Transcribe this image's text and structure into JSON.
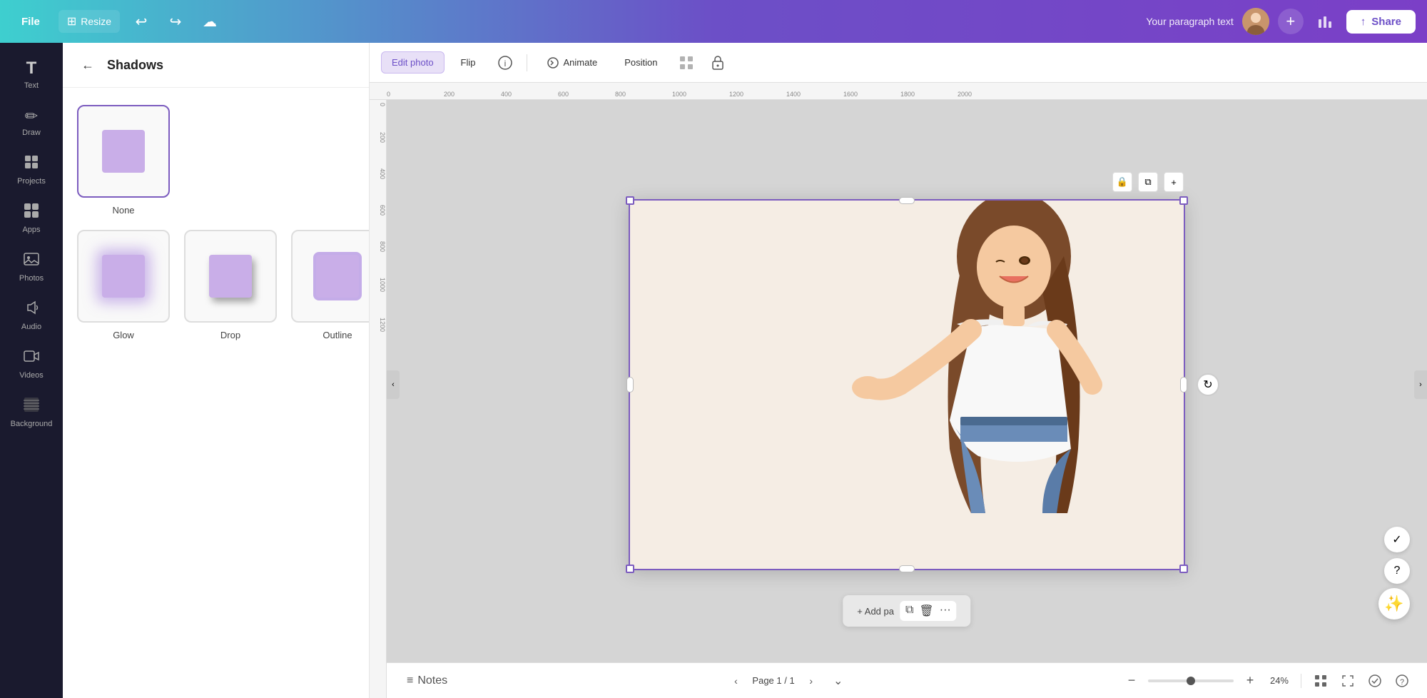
{
  "topbar": {
    "file_label": "File",
    "resize_label": "Resize",
    "undo_icon": "↩",
    "redo_icon": "↪",
    "cloud_icon": "☁",
    "paragraph_text": "Your paragraph text",
    "plus_icon": "+",
    "share_icon": "↑",
    "share_label": "Share"
  },
  "sidebar": {
    "items": [
      {
        "id": "text",
        "label": "Text",
        "icon": "T"
      },
      {
        "id": "draw",
        "label": "Draw",
        "icon": "✏"
      },
      {
        "id": "projects",
        "label": "Projects",
        "icon": "□"
      },
      {
        "id": "apps",
        "label": "Apps",
        "icon": "⊞"
      },
      {
        "id": "photos",
        "label": "Photos",
        "icon": "🖼"
      },
      {
        "id": "audio",
        "label": "Audio",
        "icon": "♪"
      },
      {
        "id": "videos",
        "label": "Videos",
        "icon": "▶"
      },
      {
        "id": "background",
        "label": "Background",
        "icon": "▨"
      }
    ]
  },
  "panel": {
    "back_icon": "←",
    "title": "Shadows",
    "shadows": [
      {
        "id": "none",
        "label": "None",
        "selected": true
      },
      {
        "id": "glow",
        "label": "Glow",
        "selected": false
      },
      {
        "id": "drop",
        "label": "Drop",
        "selected": false
      },
      {
        "id": "outline",
        "label": "Outline",
        "selected": false
      }
    ]
  },
  "toolbar": {
    "edit_photo_label": "Edit photo",
    "flip_label": "Flip",
    "info_icon": "ⓘ",
    "animate_label": "Animate",
    "position_label": "Position",
    "grid_icon": "⊞",
    "lock_icon": "🔒"
  },
  "ruler": {
    "marks": [
      "0",
      "200",
      "400",
      "600",
      "800",
      "1000",
      "1200",
      "1400",
      "1600",
      "1800",
      "2000"
    ],
    "v_marks": [
      "0",
      "200",
      "400",
      "600",
      "800",
      "1000",
      "1200"
    ]
  },
  "bottom_bar": {
    "notes_icon": "≡",
    "notes_label": "Notes",
    "page_info": "Page 1 / 1",
    "zoom_level": "24%",
    "grid_icon": "⊞",
    "expand_icon": "⤡",
    "check_icon": "✓",
    "help_icon": "?"
  },
  "canvas": {
    "add_page_text": "+ Add pa",
    "copy_icon": "⧉",
    "delete_icon": "🗑",
    "more_icon": "···"
  },
  "colors": {
    "accent_purple": "#7c5cbf",
    "light_purple": "#c9aee8",
    "bg_canvas": "#f5ede4",
    "topbar_left": "#3ecfcf",
    "topbar_right": "#7b3fc7"
  }
}
